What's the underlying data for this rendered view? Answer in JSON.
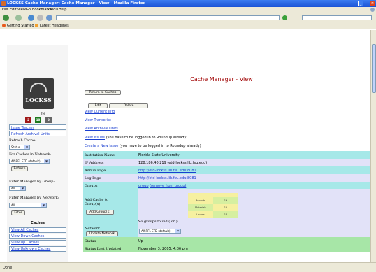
{
  "window": {
    "title": "LOCKSS Cache Manager: Cache Manager - View - Mozilla Firefox",
    "controls": [
      "_",
      "□",
      "×"
    ]
  },
  "menu": [
    "File",
    "Edit",
    "View",
    "Go",
    "Bookmarks",
    "Tools",
    "Help"
  ],
  "bookmarks": [
    "Getting Started",
    "Latest Headlines"
  ],
  "status_bar": "Done",
  "logo_text": "LOCKSS",
  "logo_tm": "TM",
  "squares": [
    {
      "label": "2",
      "color": "#a01818"
    },
    {
      "label": "18",
      "color": "#1f7a1f"
    },
    {
      "label": "0",
      "color": "#666666"
    }
  ],
  "sidebar": {
    "issue_tracker": "Issue Tracker",
    "refresh_units": "Refresh Archival Units",
    "refresh_cache_label": "Refresh Cache:",
    "status_select": "Status",
    "for_caches_label": "For Caches in Network:",
    "network_select": "AISRFL ETD (default)",
    "refresh_button": "Refresh",
    "filter_group_label": "Filter Manager by Group:",
    "group_select": "All",
    "filter_network_label": "Filter Manager by Network:",
    "network_filter_select": "All",
    "filter_button": "Filter",
    "caches_header": "Caches",
    "cache_links": [
      "View All Caches",
      "View Down Caches",
      "View Up Caches",
      "View Unknown Caches"
    ]
  },
  "main": {
    "title": "Cache Manager - View",
    "return_button": "Return to Caches",
    "edit_button": "Edit",
    "delete_button": "Delete",
    "links": [
      {
        "text": "View Current Info",
        "note": ""
      },
      {
        "text": "View Transcript",
        "note": ""
      },
      {
        "text": "View Archival Units",
        "note": ""
      },
      {
        "text": "View Issues",
        "note": " (you have to be logged in to Roundup already)"
      },
      {
        "text": "Create a New Issue",
        "note": " (you have to be logged in to Roundup already)"
      }
    ],
    "details": {
      "institution_label": "Institution Name",
      "institution_value": "Florida State University",
      "ip_label": "IP Address",
      "ip_value": "128.186.40.219 (etd-lockss.lib.fsu.edu)",
      "admin_label": "Admin Page",
      "admin_value": "http://etd-lockss.lib.fsu.edu:8081",
      "log_label": "Log Page",
      "log_value": "http://etd-lockss.lib.fsu.edu:8081",
      "groups_label": "Groups",
      "groups_link": "group",
      "groups_remove": "(remove from group)",
      "add_cache_label": "Add Cache to Group(s)",
      "add_group_button": "Add Group(s)",
      "no_groups_text": "No groups found ( or )",
      "mini_table": [
        "Records",
        "19",
        "Materials",
        "15",
        "Lockss",
        "18"
      ],
      "network_label": "Network",
      "update_network_button": "Update Network",
      "network_select": "AISRFL ETD (default)",
      "status_label": "Status",
      "status_value": "Up",
      "updated_label": "Status Last Updated",
      "updated_value": "November 3, 2005, 4:36 pm"
    }
  },
  "colors": {
    "row_cyan": "#a6e8e8",
    "row_lavender": "#e2e2f8",
    "row_green": "#a7e6a7",
    "mini_yellow": "#f6f0a0",
    "mini_green": "#d6efa0",
    "link_blue": "#1a3fd0"
  }
}
